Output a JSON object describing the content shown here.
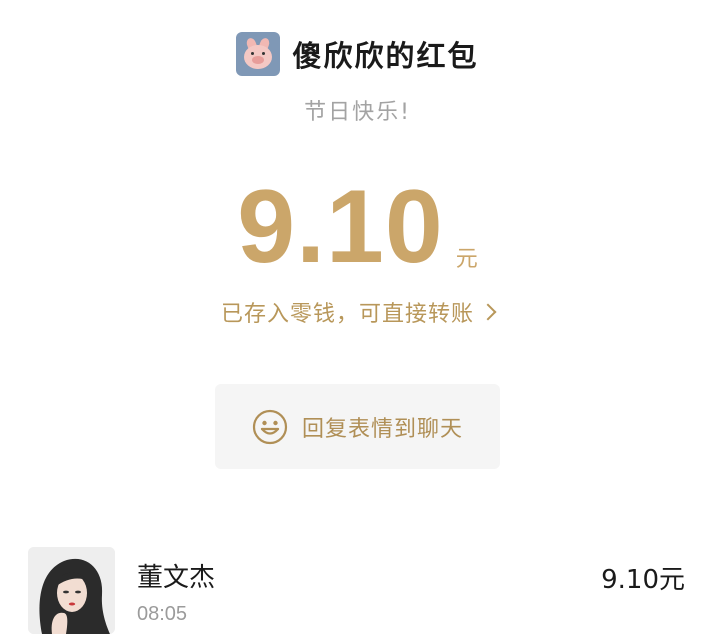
{
  "header": {
    "sender_avatar_icon": "pig-avatar-icon",
    "title": "傻欣欣的红包"
  },
  "greeting": "节日快乐!",
  "amount": {
    "value": "9.10",
    "unit": "元"
  },
  "deposit_link": {
    "label": "已存入零钱，可直接转账",
    "icon": "chevron-right-icon"
  },
  "reply_button": {
    "icon": "smile-icon",
    "label": "回复表情到聊天"
  },
  "receivers": [
    {
      "name": "董文杰",
      "time": "08:05",
      "amount": "9.10元",
      "avatar_icon": "user-avatar"
    }
  ],
  "colors": {
    "gold": "#cba66a",
    "gold_dark": "#b08f56",
    "gray_text": "#a3a3a3",
    "button_bg": "#f5f5f5"
  }
}
